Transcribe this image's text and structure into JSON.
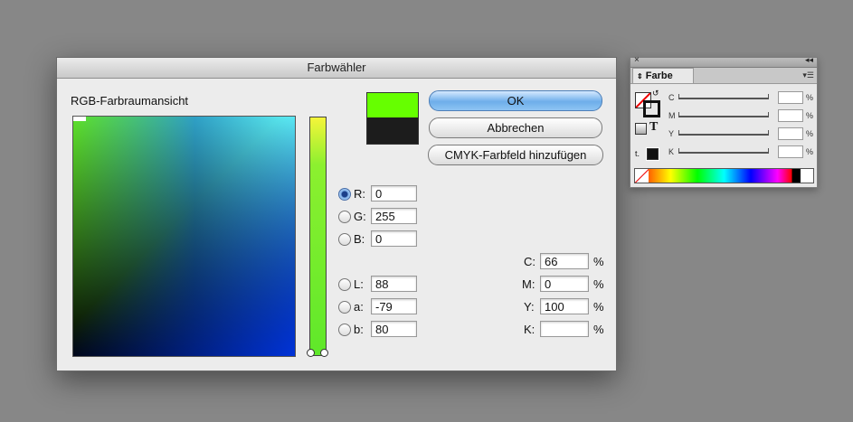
{
  "dialog": {
    "title": "Farbwähler",
    "field_label": "RGB-Farbraumansicht",
    "swatch_new_color": "#66ff00",
    "swatch_old_color": "#1c1c1c",
    "buttons": {
      "ok": "OK",
      "cancel": "Abbrechen",
      "add_swatch": "CMYK-Farbfeld hinzufügen"
    },
    "rgb": [
      {
        "label": "R:",
        "value": "0",
        "selected": true
      },
      {
        "label": "G:",
        "value": "255",
        "selected": false
      },
      {
        "label": "B:",
        "value": "0",
        "selected": false
      }
    ],
    "lab": [
      {
        "label": "L:",
        "value": "88"
      },
      {
        "label": "a:",
        "value": "-79"
      },
      {
        "label": "b:",
        "value": "80"
      }
    ],
    "cmyk": [
      {
        "label": "C:",
        "value": "66",
        "unit": "%"
      },
      {
        "label": "M:",
        "value": "0",
        "unit": "%"
      },
      {
        "label": "Y:",
        "value": "100",
        "unit": "%"
      },
      {
        "label": "K:",
        "value": "",
        "unit": "%"
      }
    ]
  },
  "panel": {
    "tab": "Farbe",
    "rows": [
      {
        "label": "C",
        "unit": "%"
      },
      {
        "label": "M",
        "unit": "%"
      },
      {
        "label": "Y",
        "unit": "%"
      },
      {
        "label": "K",
        "unit": "%"
      }
    ],
    "text_mode_glyph": "T"
  }
}
